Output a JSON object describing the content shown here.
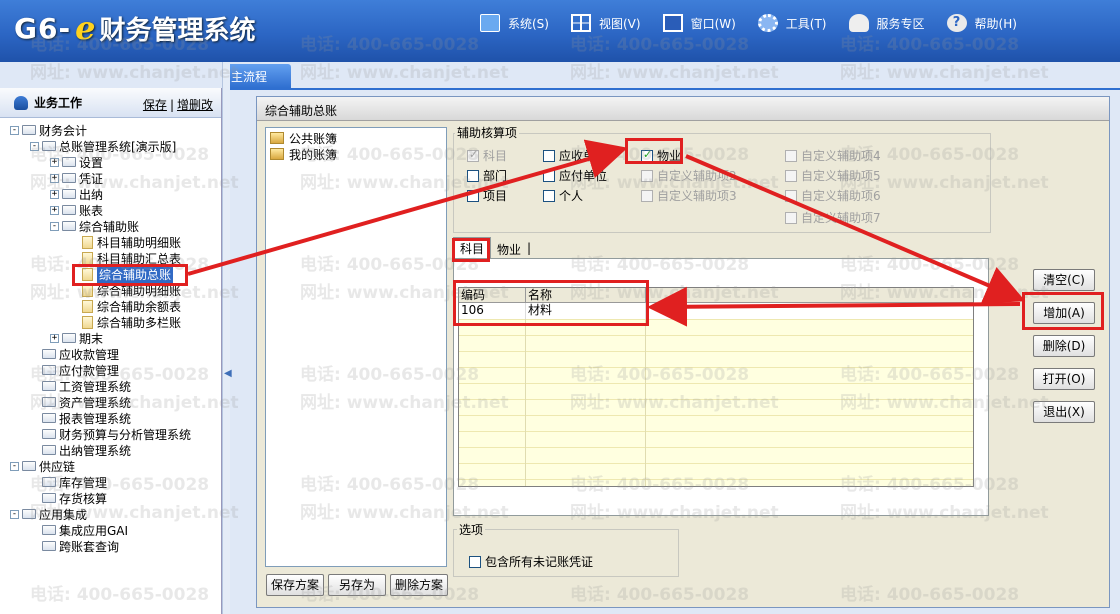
{
  "app": {
    "logo_g6": "G6-",
    "logo_e": "e",
    "logo_title": "财务管理系统",
    "menu": [
      {
        "label": "系统(S)",
        "icon": "monitor-icon"
      },
      {
        "label": "视图(V)",
        "icon": "grid-view-icon"
      },
      {
        "label": "窗口(W)",
        "icon": "window-icon"
      },
      {
        "label": "工具(T)",
        "icon": "gear-icon"
      },
      {
        "label": "服务专区",
        "icon": "service-person-icon"
      },
      {
        "label": "帮助(H)",
        "icon": "help-icon"
      }
    ]
  },
  "tabs": {
    "main": "主流程"
  },
  "left_panel": {
    "title": "业务工作",
    "save_link": "保存",
    "separator": "|",
    "edit_link": "增删改",
    "tree": [
      {
        "label": "财务会计",
        "type": "folder",
        "expander": "-"
      },
      {
        "label": "总账管理系统[演示版]",
        "type": "folder",
        "expander": "-"
      },
      {
        "label": "设置",
        "type": "folder",
        "expander": "+"
      },
      {
        "label": "凭证",
        "type": "folder",
        "expander": "+"
      },
      {
        "label": "出纳",
        "type": "folder",
        "expander": "+"
      },
      {
        "label": "账表",
        "type": "folder",
        "expander": "+"
      },
      {
        "label": "综合辅助账",
        "type": "folder",
        "expander": "-"
      },
      {
        "label": "科目辅助明细账",
        "type": "doc"
      },
      {
        "label": "科目辅助汇总表",
        "type": "doc"
      },
      {
        "label": "综合辅助总账",
        "type": "doc",
        "selected": true
      },
      {
        "label": "综合辅助明细账",
        "type": "doc"
      },
      {
        "label": "综合辅助余额表",
        "type": "doc"
      },
      {
        "label": "综合辅助多栏账",
        "type": "doc"
      },
      {
        "label": "期末",
        "type": "folder",
        "expander": "+"
      },
      {
        "label": "应收款管理",
        "type": "folder"
      },
      {
        "label": "应付款管理",
        "type": "folder"
      },
      {
        "label": "工资管理系统",
        "type": "folder"
      },
      {
        "label": "资产管理系统",
        "type": "folder"
      },
      {
        "label": "报表管理系统",
        "type": "folder"
      },
      {
        "label": "财务预算与分析管理系统",
        "type": "folder"
      },
      {
        "label": "出纳管理系统",
        "type": "folder"
      },
      {
        "label": "供应链",
        "type": "folder",
        "expander": "-"
      },
      {
        "label": "库存管理",
        "type": "folder"
      },
      {
        "label": "存货核算",
        "type": "folder"
      },
      {
        "label": "应用集成",
        "type": "folder",
        "expander": "-"
      },
      {
        "label": "集成应用GAI",
        "type": "folder"
      },
      {
        "label": "跨账套查询",
        "type": "folder"
      }
    ]
  },
  "dialog": {
    "title": "综合辅助总账",
    "schemes": [
      "公共账簿",
      "我的账簿"
    ],
    "scheme_buttons": {
      "save": "保存方案",
      "save_as": "另存为",
      "delete": "删除方案"
    },
    "aux_group_label": "辅助核算项",
    "aux_items": [
      {
        "label": "科目",
        "checked": true,
        "disabled": true
      },
      {
        "label": "应收单位",
        "checked": false,
        "disabled": false
      },
      {
        "label": "物业",
        "checked": true,
        "disabled": false
      },
      {
        "label": "自定义辅助项4",
        "checked": false,
        "disabled": true
      },
      {
        "label": "部门",
        "checked": false,
        "disabled": false
      },
      {
        "label": "应付单位",
        "checked": false,
        "disabled": false
      },
      {
        "label": "自定义辅助项2",
        "checked": false,
        "disabled": true
      },
      {
        "label": "自定义辅助项5",
        "checked": false,
        "disabled": true
      },
      {
        "label": "项目",
        "checked": false,
        "disabled": false
      },
      {
        "label": "个人",
        "checked": false,
        "disabled": false
      },
      {
        "label": "自定义辅助项3",
        "checked": false,
        "disabled": true
      },
      {
        "label": "自定义辅助项6",
        "checked": false,
        "disabled": true
      },
      {
        "label": "自定义辅助项7",
        "checked": false,
        "disabled": true
      }
    ],
    "inner_tabs": [
      "科目",
      "物业"
    ],
    "inner_tab_separator": "|",
    "grid": {
      "columns": [
        "编码",
        "名称"
      ],
      "rows": [
        {
          "code": "106",
          "name": "材料"
        }
      ]
    },
    "options_label": "选项",
    "include_unposted": {
      "label": "包含所有未记账凭证",
      "checked": false
    },
    "buttons": {
      "clear": "清空(C)",
      "add": "增加(A)",
      "delete": "删除(D)",
      "open": "打开(O)",
      "exit": "退出(X)"
    }
  },
  "watermark": {
    "phone": "电话: 400-665-0028",
    "site": "网址: www.chanjet.net"
  },
  "colors": {
    "accent": "#2c66c4",
    "highlight": "#e02020",
    "selection": "#316ac5"
  }
}
